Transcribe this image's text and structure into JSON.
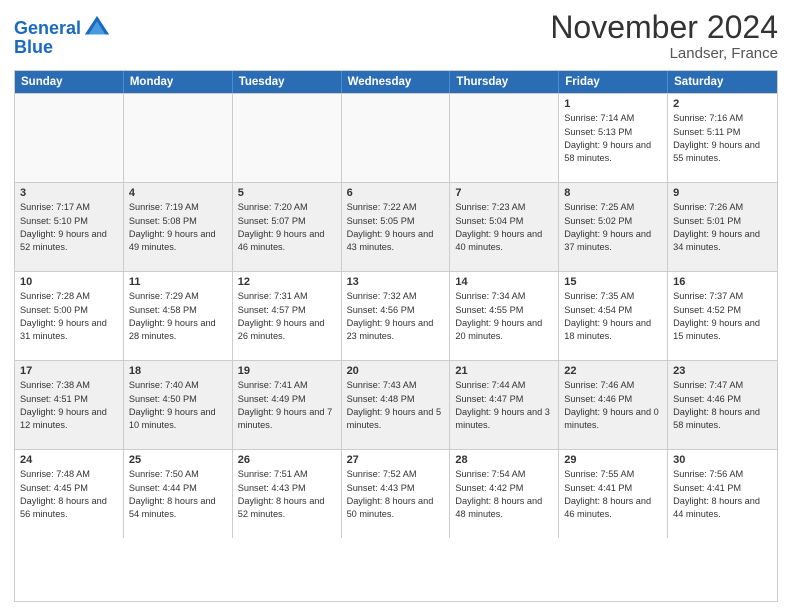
{
  "logo": {
    "line1": "General",
    "line2": "Blue"
  },
  "title": "November 2024",
  "location": "Landser, France",
  "days_of_week": [
    "Sunday",
    "Monday",
    "Tuesday",
    "Wednesday",
    "Thursday",
    "Friday",
    "Saturday"
  ],
  "rows": [
    [
      {
        "day": "",
        "info": "",
        "empty": true
      },
      {
        "day": "",
        "info": "",
        "empty": true
      },
      {
        "day": "",
        "info": "",
        "empty": true
      },
      {
        "day": "",
        "info": "",
        "empty": true
      },
      {
        "day": "",
        "info": "",
        "empty": true
      },
      {
        "day": "1",
        "info": "Sunrise: 7:14 AM\nSunset: 5:13 PM\nDaylight: 9 hours and 58 minutes."
      },
      {
        "day": "2",
        "info": "Sunrise: 7:16 AM\nSunset: 5:11 PM\nDaylight: 9 hours and 55 minutes."
      }
    ],
    [
      {
        "day": "3",
        "info": "Sunrise: 7:17 AM\nSunset: 5:10 PM\nDaylight: 9 hours and 52 minutes."
      },
      {
        "day": "4",
        "info": "Sunrise: 7:19 AM\nSunset: 5:08 PM\nDaylight: 9 hours and 49 minutes."
      },
      {
        "day": "5",
        "info": "Sunrise: 7:20 AM\nSunset: 5:07 PM\nDaylight: 9 hours and 46 minutes."
      },
      {
        "day": "6",
        "info": "Sunrise: 7:22 AM\nSunset: 5:05 PM\nDaylight: 9 hours and 43 minutes."
      },
      {
        "day": "7",
        "info": "Sunrise: 7:23 AM\nSunset: 5:04 PM\nDaylight: 9 hours and 40 minutes."
      },
      {
        "day": "8",
        "info": "Sunrise: 7:25 AM\nSunset: 5:02 PM\nDaylight: 9 hours and 37 minutes."
      },
      {
        "day": "9",
        "info": "Sunrise: 7:26 AM\nSunset: 5:01 PM\nDaylight: 9 hours and 34 minutes."
      }
    ],
    [
      {
        "day": "10",
        "info": "Sunrise: 7:28 AM\nSunset: 5:00 PM\nDaylight: 9 hours and 31 minutes."
      },
      {
        "day": "11",
        "info": "Sunrise: 7:29 AM\nSunset: 4:58 PM\nDaylight: 9 hours and 28 minutes."
      },
      {
        "day": "12",
        "info": "Sunrise: 7:31 AM\nSunset: 4:57 PM\nDaylight: 9 hours and 26 minutes."
      },
      {
        "day": "13",
        "info": "Sunrise: 7:32 AM\nSunset: 4:56 PM\nDaylight: 9 hours and 23 minutes."
      },
      {
        "day": "14",
        "info": "Sunrise: 7:34 AM\nSunset: 4:55 PM\nDaylight: 9 hours and 20 minutes."
      },
      {
        "day": "15",
        "info": "Sunrise: 7:35 AM\nSunset: 4:54 PM\nDaylight: 9 hours and 18 minutes."
      },
      {
        "day": "16",
        "info": "Sunrise: 7:37 AM\nSunset: 4:52 PM\nDaylight: 9 hours and 15 minutes."
      }
    ],
    [
      {
        "day": "17",
        "info": "Sunrise: 7:38 AM\nSunset: 4:51 PM\nDaylight: 9 hours and 12 minutes."
      },
      {
        "day": "18",
        "info": "Sunrise: 7:40 AM\nSunset: 4:50 PM\nDaylight: 9 hours and 10 minutes."
      },
      {
        "day": "19",
        "info": "Sunrise: 7:41 AM\nSunset: 4:49 PM\nDaylight: 9 hours and 7 minutes."
      },
      {
        "day": "20",
        "info": "Sunrise: 7:43 AM\nSunset: 4:48 PM\nDaylight: 9 hours and 5 minutes."
      },
      {
        "day": "21",
        "info": "Sunrise: 7:44 AM\nSunset: 4:47 PM\nDaylight: 9 hours and 3 minutes."
      },
      {
        "day": "22",
        "info": "Sunrise: 7:46 AM\nSunset: 4:46 PM\nDaylight: 9 hours and 0 minutes."
      },
      {
        "day": "23",
        "info": "Sunrise: 7:47 AM\nSunset: 4:46 PM\nDaylight: 8 hours and 58 minutes."
      }
    ],
    [
      {
        "day": "24",
        "info": "Sunrise: 7:48 AM\nSunset: 4:45 PM\nDaylight: 8 hours and 56 minutes."
      },
      {
        "day": "25",
        "info": "Sunrise: 7:50 AM\nSunset: 4:44 PM\nDaylight: 8 hours and 54 minutes."
      },
      {
        "day": "26",
        "info": "Sunrise: 7:51 AM\nSunset: 4:43 PM\nDaylight: 8 hours and 52 minutes."
      },
      {
        "day": "27",
        "info": "Sunrise: 7:52 AM\nSunset: 4:43 PM\nDaylight: 8 hours and 50 minutes."
      },
      {
        "day": "28",
        "info": "Sunrise: 7:54 AM\nSunset: 4:42 PM\nDaylight: 8 hours and 48 minutes."
      },
      {
        "day": "29",
        "info": "Sunrise: 7:55 AM\nSunset: 4:41 PM\nDaylight: 8 hours and 46 minutes."
      },
      {
        "day": "30",
        "info": "Sunrise: 7:56 AM\nSunset: 4:41 PM\nDaylight: 8 hours and 44 minutes."
      }
    ]
  ]
}
